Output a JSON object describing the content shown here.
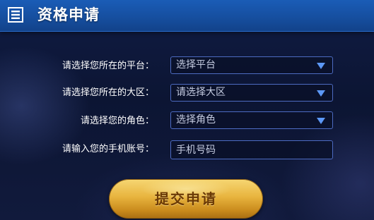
{
  "header": {
    "title": "资格申请",
    "icon": "list-icon"
  },
  "form": {
    "platform": {
      "label": "请选择您所在的平台：",
      "selected": "选择平台"
    },
    "region": {
      "label": "请选择您所在的大区：",
      "selected": "请选择大区"
    },
    "role": {
      "label": "请选择您的角色：",
      "selected": "选择角色"
    },
    "phone": {
      "label": "请输入您的手机账号：",
      "placeholder": "手机号码",
      "value": ""
    },
    "submit_label": "提交申请"
  },
  "colors": {
    "header_blue": "#164fa0",
    "background": "#0c1533",
    "field_border": "#4d6bc2",
    "caret": "#5c98f6",
    "button_gold": "#e8b43e",
    "button_text": "#6b3a06"
  }
}
